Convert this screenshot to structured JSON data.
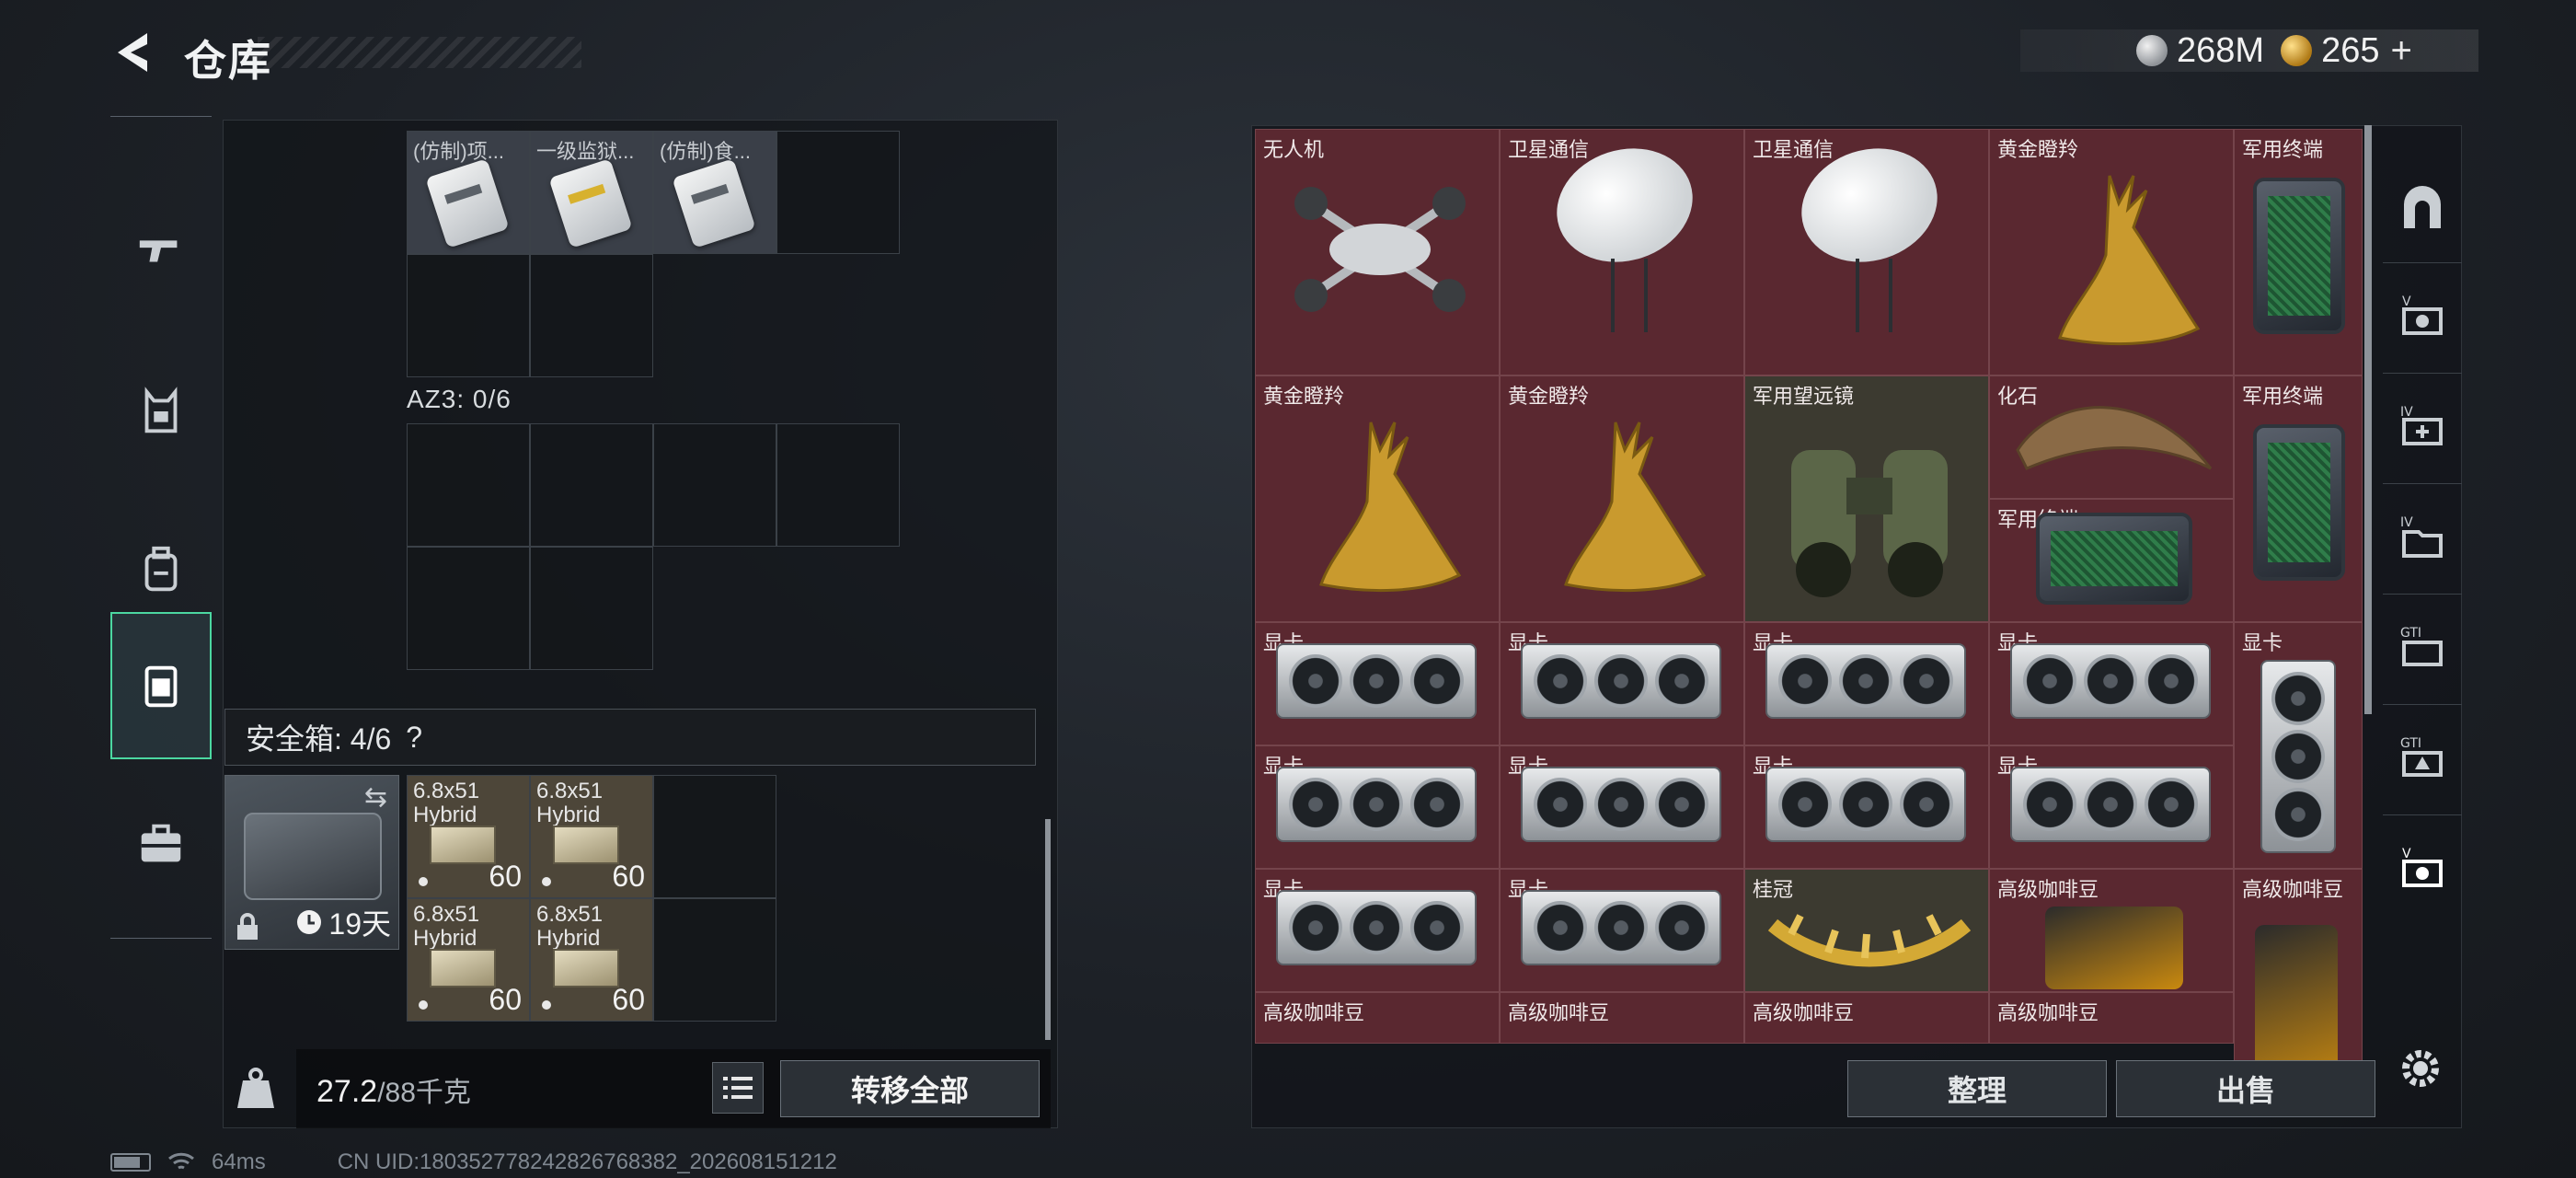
{
  "header": {
    "title": "仓库"
  },
  "currency": {
    "silver": "268M",
    "gold": "265",
    "plus": "+"
  },
  "left_nav": [
    "gun-icon",
    "vest-icon",
    "backpack-icon",
    "container-icon",
    "briefcase-icon"
  ],
  "storage": {
    "top_items": [
      "(仿制)项...",
      "一级监狱...",
      "(仿制)食..."
    ],
    "az3_label": "AZ3: 0/6"
  },
  "safe": {
    "header": "安全箱: 4/6",
    "help": "?",
    "days": "19天",
    "ammo": [
      {
        "line1": "6.8x51",
        "line2": "Hybrid",
        "count": "60"
      },
      {
        "line1": "6.8x51",
        "line2": "Hybrid",
        "count": "60"
      },
      {
        "line1": "6.8x51",
        "line2": "Hybrid",
        "count": "60"
      },
      {
        "line1": "6.8x51",
        "line2": "Hybrid",
        "count": "60"
      }
    ]
  },
  "weight": {
    "value": "27.2",
    "unit": "/88千克"
  },
  "buttons": {
    "transfer_all": "转移全部",
    "sort": "整理",
    "sell": "出售"
  },
  "right_grid": {
    "row1": [
      "无人机",
      "卫星通信",
      "卫星通信",
      "黄金瞪羚",
      "军用终端"
    ],
    "row2": [
      "黄金瞪羚",
      "黄金瞪羚",
      "军用望远镜",
      "化石",
      "军用终端",
      "军用终端"
    ],
    "gpu_label": "显卡",
    "row5": [
      "显卡",
      "显卡",
      "桂冠",
      "高级咖啡豆",
      "高级咖啡豆"
    ],
    "row6": [
      "高级咖啡豆",
      "高级咖啡豆",
      "高级咖啡豆",
      "高级咖啡豆"
    ]
  },
  "status": {
    "ping": "64ms",
    "uid": "CN UID:180352778242826768382_202608151212"
  }
}
